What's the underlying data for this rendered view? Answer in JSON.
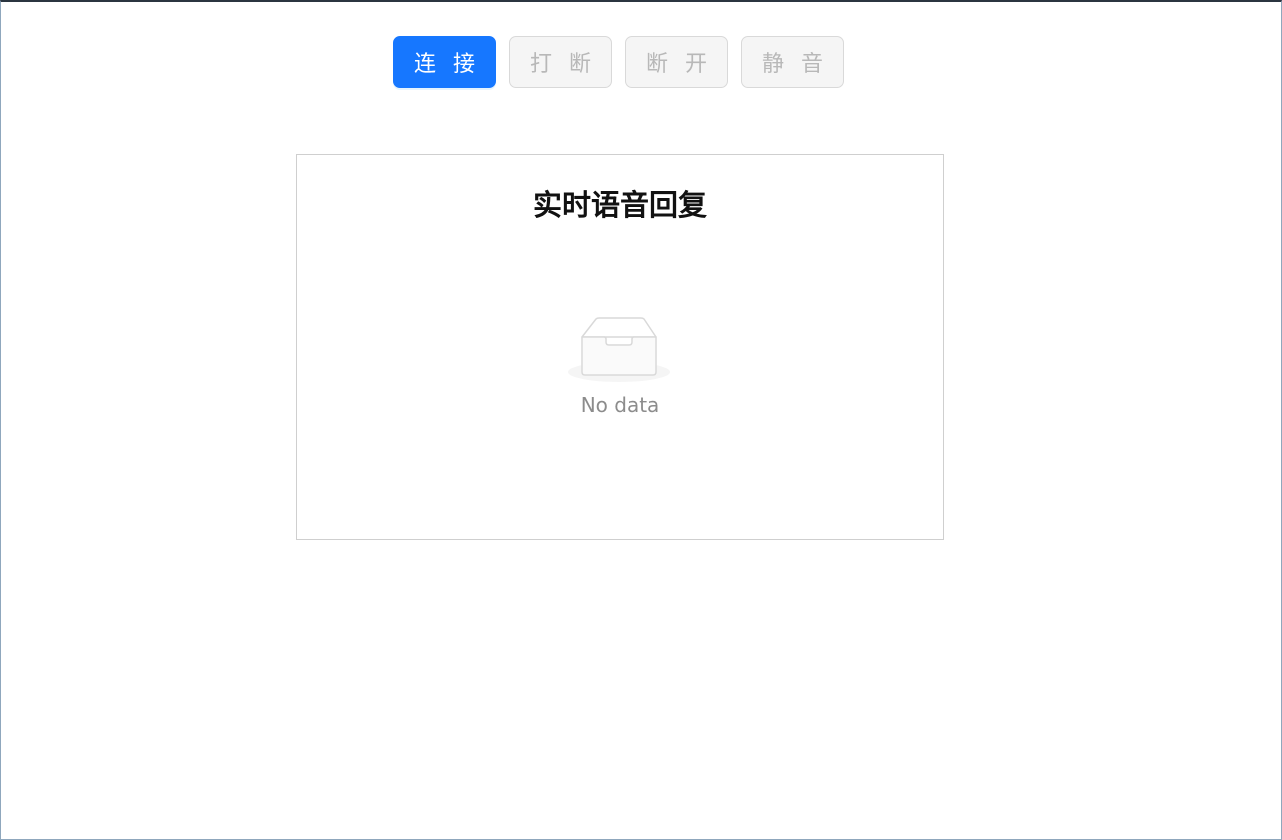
{
  "toolbar": {
    "connect_label": "连 接",
    "interrupt_label": "打 断",
    "disconnect_label": "断 开",
    "mute_label": "静 音"
  },
  "panel": {
    "title": "实时语音回复",
    "empty_text": "No data",
    "empty_icon": "empty-inbox-icon"
  },
  "colors": {
    "primary": "#1677ff",
    "disabled_bg": "#f5f5f5",
    "disabled_text": "#b8b8b8",
    "border": "#d9d9d9"
  }
}
